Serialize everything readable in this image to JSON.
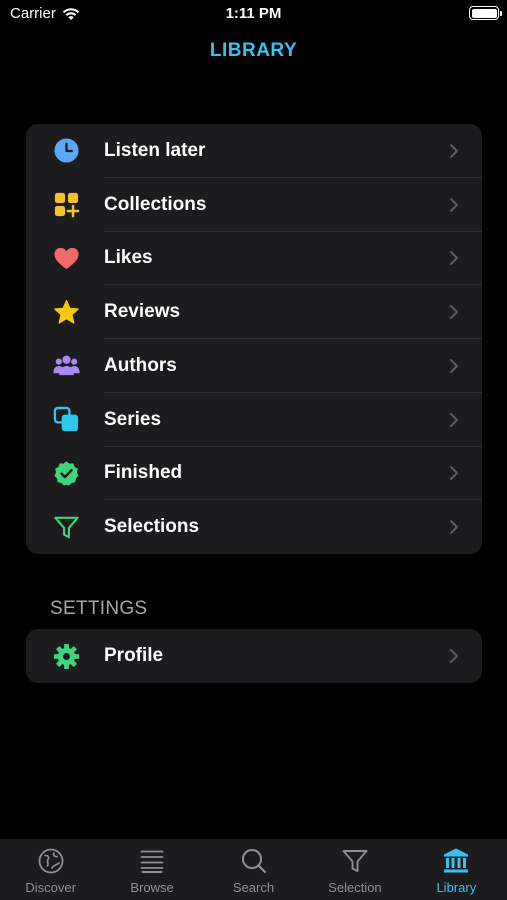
{
  "status_bar": {
    "carrier": "Carrier",
    "time": "1:11 PM"
  },
  "header": {
    "title": "LIBRARY"
  },
  "library": {
    "items": [
      {
        "label": "Listen later",
        "icon": "clock-icon",
        "color": "#5aa8f5"
      },
      {
        "label": "Collections",
        "icon": "collections-icon",
        "color": "#f6c22b"
      },
      {
        "label": "Likes",
        "icon": "heart-icon",
        "color": "#f26b6b"
      },
      {
        "label": "Reviews",
        "icon": "star-icon",
        "color": "#f6c80f"
      },
      {
        "label": "Authors",
        "icon": "people-icon",
        "color": "#a78bf0"
      },
      {
        "label": "Series",
        "icon": "series-icon",
        "color": "#2fc6ef"
      },
      {
        "label": "Finished",
        "icon": "checkmark-seal-icon",
        "color": "#3ed57a"
      },
      {
        "label": "Selections",
        "icon": "funnel-icon",
        "color": "#3ed57a"
      }
    ]
  },
  "settings": {
    "header": "SETTINGS",
    "items": [
      {
        "label": "Profile",
        "icon": "gear-icon",
        "color": "#3ed57a"
      }
    ]
  },
  "tab_bar": {
    "active_color": "#35c2f0",
    "inactive_color": "#8e8e93",
    "tabs": [
      {
        "label": "Discover",
        "icon": "globe-icon",
        "active": false
      },
      {
        "label": "Browse",
        "icon": "list-icon",
        "active": false
      },
      {
        "label": "Search",
        "icon": "search-icon",
        "active": false
      },
      {
        "label": "Selection",
        "icon": "funnel-icon",
        "active": false
      },
      {
        "label": "Library",
        "icon": "library-icon",
        "active": true
      }
    ]
  }
}
